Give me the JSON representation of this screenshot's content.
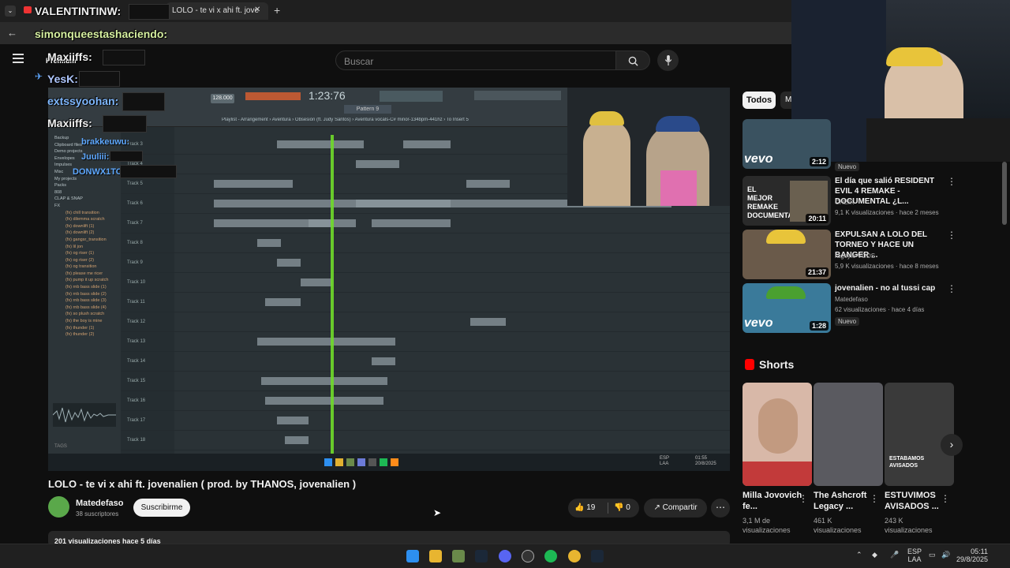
{
  "browser": {
    "tab_title": "LOLO - te vi x ahi ft. jove",
    "new_tab": "+",
    "back": "←"
  },
  "chat_overlay": [
    {
      "name": "VALENTINTINW:"
    },
    {
      "name": "simonqueestashaciendo:"
    },
    {
      "name": "Maxiiffs:"
    },
    {
      "name": "YesK:"
    },
    {
      "name": "extssyoohan:"
    },
    {
      "name": "Maxiiffs:"
    },
    {
      "name": "brakkeuwu:"
    },
    {
      "name": "Juuliii:"
    },
    {
      "name": "DONWX1TO:"
    }
  ],
  "youtube": {
    "brand_partial": "Premium",
    "search_placeholder": "Buscar",
    "search_icon": "search-icon",
    "mic_icon": "mic-icon",
    "menu_icon": "hamburger-icon"
  },
  "video_frame": {
    "fl_time": "1:23:76",
    "fl_bpm": "128.000",
    "fl_pattern": "Pattern 9",
    "fl_playlist_title": "Playlist - Arrangement › Aventura › Obsesión (ft. Judy Santos) › Aventura vocals-C# minor-134bpm-441hz › To Insert 5",
    "browser_items": [
      "Backup",
      "Clipboard files",
      "Demo projects",
      "Envelopes",
      "Impulses",
      "Misc",
      "My projects",
      "Packs",
      "808",
      "CLAP & SNAP",
      "FX",
      "(fx) chill transition",
      "(fx) dilemma scratch",
      "(fx) downlift (1)",
      "(fx) downlift (2)",
      "(fx) gangsr_transition",
      "(fx) lil jon",
      "(fx) og riser (1)",
      "(fx) og riser (2)",
      "(fx) og transition",
      "(fx) please me ricer",
      "(fx) pump it up scratch",
      "(fx) rnb bass slide (1)",
      "(fx) rnb bass slide (2)",
      "(fx) rnb bass slide (3)",
      "(fx) rnb bass slide (4)",
      "(fx) so plush scratch",
      "(fx) the boy is mine",
      "(fx) thunder (1)",
      "(fx) thunder (2)"
    ],
    "tracks": [
      "Track 3",
      "Track 4",
      "Track 5",
      "Track 6",
      "Track 7",
      "Track 8",
      "Track 9",
      "Track 10",
      "Track 11",
      "Track 12",
      "Track 13",
      "Track 14",
      "Track 15",
      "Track 16",
      "Track 17",
      "Track 18"
    ],
    "taskbar_lang": "ESP\nLAA",
    "taskbar_time": "01:55",
    "taskbar_date": "20/8/2025",
    "tags_label": "TAGS"
  },
  "video": {
    "title": "LOLO - te vi x ahi ft. jovenalien ( prod. by THANOS, jovenalien )",
    "channel": "Matedefaso",
    "subscribers": "38 suscriptores",
    "subscribe": "Suscribirme",
    "likes": "19",
    "dislikes": "0",
    "share": "Compartir",
    "more": "⋯",
    "description_stats": "201 visualizaciones  hace 5 días"
  },
  "sidebar": {
    "chip_all": "Todos",
    "chip_next": "M",
    "videos": [
      {
        "title": "",
        "channel": "",
        "meta": "",
        "duration": "2:12",
        "badge": "Nuevo",
        "brand": "vevo"
      },
      {
        "title": "El día que salió RESIDENT EVIL 4 REMAKE - DOCUMENTAL ¿L...",
        "channel": "CHEIK",
        "meta": "9,1 K visualizaciones · hace 2 meses",
        "duration": "20:11",
        "thumb_text": "EL MEJOR REMAKE DOCUMENTAL"
      },
      {
        "title": "EXPULSAN A LOLO DEL TORNEO Y HACE UN BANGER ...",
        "channel": "rageylo VODS",
        "meta": "5,9 K visualizaciones · hace 8 meses",
        "duration": "21:37"
      },
      {
        "title": "jovenalien - no al tussi cap",
        "channel": "Matedefaso",
        "meta": "62 visualizaciones · hace 4 días",
        "duration": "1:28",
        "badge": "Nuevo",
        "brand": "vevo"
      }
    ],
    "shorts_heading": "Shorts",
    "shorts": [
      {
        "title": "Milla Jovovich fe...",
        "views1": "3,1 M de",
        "views2": "visualizaciones"
      },
      {
        "title": "The Ashcroft Legacy ...",
        "views1": "461 K",
        "views2": "visualizaciones"
      },
      {
        "title": "ESTUVIMOS AVISADOS ...",
        "views1": "243 K",
        "views2": "visualizaciones",
        "thumb_text": "ESTABAMOS AVISADOS"
      }
    ],
    "next_arrow": "›"
  },
  "taskbar": {
    "lang1": "ESP",
    "lang2": "LAA",
    "time": "05:11",
    "date": "29/8/2025"
  },
  "colors": {
    "yt_bg": "#0f0f0f",
    "accent_red": "#ff0000",
    "fl_green": "#6fda2a",
    "chat_blue": "#5ea8ff"
  }
}
